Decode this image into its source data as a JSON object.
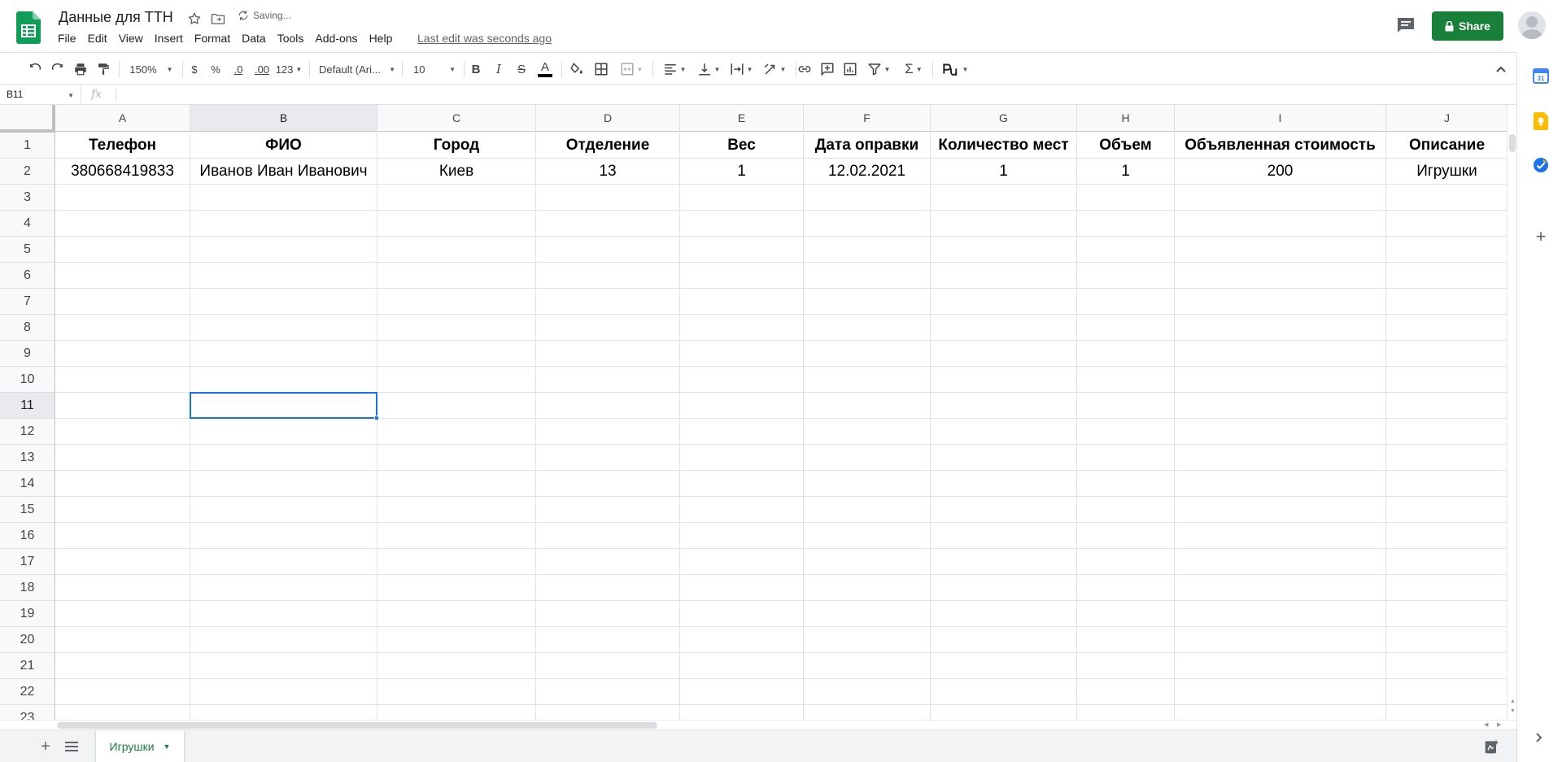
{
  "header": {
    "doc_title": "Данные для ТТН",
    "saving_status": "Saving...",
    "last_edit": "Last edit was seconds ago",
    "share_label": "Share",
    "menu": [
      "File",
      "Edit",
      "View",
      "Insert",
      "Format",
      "Data",
      "Tools",
      "Add-ons",
      "Help"
    ]
  },
  "toolbar": {
    "zoom": "150%",
    "currency": "$",
    "percent": "%",
    "decrease_decimal": ".0",
    "increase_decimal": ".00",
    "more_formats": "123",
    "font_family": "Default (Ari...",
    "font_size": "10"
  },
  "formula_bar": {
    "name_box": "B11",
    "fx": "fx",
    "value": ""
  },
  "sheet": {
    "columns": [
      "A",
      "B",
      "C",
      "D",
      "E",
      "F",
      "G",
      "H",
      "I",
      "J"
    ],
    "rows": [
      "1",
      "2",
      "3",
      "4",
      "5",
      "6",
      "7",
      "8",
      "9",
      "10",
      "11",
      "12",
      "13",
      "14",
      "15",
      "16",
      "17",
      "18",
      "19",
      "20",
      "21",
      "22",
      "23"
    ],
    "header_row": [
      "Телефон",
      "ФИО",
      "Город",
      "Отделение",
      "Вес",
      "Дата оправки",
      "Количество мест",
      "Объем",
      "Объявленная стоимость",
      "Описание"
    ],
    "data_row": [
      "380668419833",
      "Иванов Иван Иванович",
      "Киев",
      "13",
      "1",
      "12.02.2021",
      "1",
      "1",
      "200",
      "Игрушки"
    ],
    "selected_cell": "B11"
  },
  "sheet_tabs": [
    {
      "label": "Игрушки",
      "active": true
    }
  ],
  "colors": {
    "accent_green": "#188038",
    "selection_blue": "#1a73e8"
  }
}
